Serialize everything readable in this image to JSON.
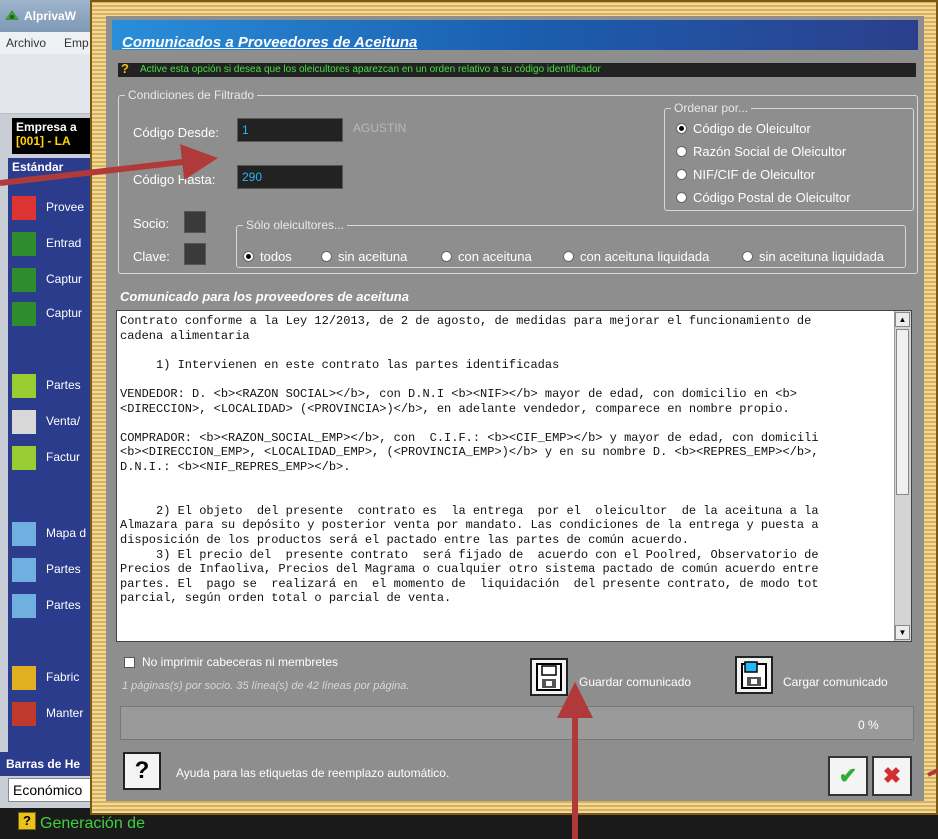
{
  "background_app": {
    "title": "AlprivaW",
    "menu": [
      "Archivo",
      "Emp"
    ],
    "company_line1": "Empresa a",
    "company_line2": "[001] - LA",
    "sidebar_header": "Estándar",
    "sidebar_items": [
      {
        "label": "Provee",
        "icon": "arrow-icon"
      },
      {
        "label": "Entrad",
        "icon": "olive-branch-icon"
      },
      {
        "label": "Captur",
        "icon": "olive-branch-icon"
      },
      {
        "label": "Captur",
        "icon": "olive-branch-icon"
      },
      {
        "label": "Partes",
        "icon": "jar-icon"
      },
      {
        "label": "Venta/",
        "icon": "document-icon"
      },
      {
        "label": "Factur",
        "icon": "jar-icon"
      },
      {
        "label": "Mapa d",
        "icon": "bars-icon"
      },
      {
        "label": "Partes",
        "icon": "bars-icon"
      },
      {
        "label": "Partes",
        "icon": "bars-icon"
      },
      {
        "label": "Fabric",
        "icon": "factory-icon"
      },
      {
        "label": "Manter",
        "icon": "maintenance-icon"
      }
    ],
    "barras_label": "Barras de He",
    "economico_value": "Económico",
    "status_text": "Generación de"
  },
  "dialog": {
    "title": "Comunicados a Proveedores de Aceituna",
    "hint": "Active esta opción si desea que los oleicultores aparezcan en un orden relativo a su código identificador",
    "filter_legend": "Condiciones de Filtrado",
    "codigo_desde_label": "Código Desde:",
    "codigo_desde_value": "1",
    "codigo_desde_name": "AGUSTIN",
    "codigo_hasta_label": "Código Hasta:",
    "codigo_hasta_value": "290",
    "socio_label": "Socio:",
    "clave_label": "Clave:",
    "order_legend": "Ordenar por...",
    "order_options": [
      {
        "label": "Código de Oleicultor",
        "selected": true
      },
      {
        "label": "Razón Social de Oleicultor",
        "selected": false
      },
      {
        "label": "NIF/CIF de Oleicultor",
        "selected": false
      },
      {
        "label": "Código Postal de Oleicultor",
        "selected": false
      }
    ],
    "solo_legend": "Sólo oleicultores...",
    "solo_options": [
      {
        "label": "todos",
        "selected": true
      },
      {
        "label": "sin aceituna",
        "selected": false
      },
      {
        "label": "con aceituna",
        "selected": false
      },
      {
        "label": "con aceituna liquidada",
        "selected": false
      },
      {
        "label": "sin aceituna liquidada",
        "selected": false
      }
    ],
    "comunicado_title": "Comunicado para los proveedores de aceituna",
    "comunicado_text": [
      "Contrato conforme a la Ley 12/2013, de 2 de agosto, de medidas para mejorar el funcionamiento de",
      "cadena alimentaria",
      "",
      "     1) Intervienen en este contrato las partes identificadas",
      "",
      "VENDEDOR: D. <b><RAZON SOCIAL></b>, con D.N.I <b><NIF></b> mayor de edad, con domicilio en <b>",
      "<DIRECCION>, <LOCALIDAD> (<PROVINCIA>)</b>, en adelante vendedor, comparece en nombre propio.",
      "",
      "COMPRADOR: <b><RAZON_SOCIAL_EMP></b>, con  C.I.F.: <b><CIF_EMP></b> y mayor de edad, con domicili",
      "<b><DIRECCION_EMP>, <LOCALIDAD_EMP>, (<PROVINCIA_EMP>)</b> y en su nombre D. <b><REPRES_EMP></b>,",
      "D.N.I.: <b><NIF_REPRES_EMP></b>.",
      "",
      "",
      "     2) El objeto  del presente  contrato es  la entrega  por el  oleicultor  de la aceituna a la",
      "Almazara para su depósito y posterior venta por mandato. Las condiciones de la entrega y puesta a",
      "disposición de los productos será el pactado entre las partes de común acuerdo.",
      "     3) El precio del  presente contrato  será fijado de  acuerdo con el Poolred, Observatorio de",
      "Precios de Infaoliva, Precios del Magrama o cualquier otro sistema pactado de común acuerdo entre",
      "partes. El  pago se  realizará en  el momento de  liquidación  del presente contrato, de modo tot",
      "parcial, según orden total o parcial de venta."
    ],
    "no_imprimir_label": "No imprimir cabeceras ni membretes",
    "no_imprimir_checked": false,
    "pages_info": "1 páginas(s) por socio. 35 línea(s) de 42 líneas por página.",
    "guardar_label": "Guardar comunicado",
    "cargar_label": "Cargar comunicado",
    "progress_value": 0,
    "progress_text": "0 %",
    "help_symbol": "?",
    "help_label": "Ayuda para las etiquetas de reemplazo automático.",
    "ok_symbol": "✔",
    "cancel_symbol": "✖"
  },
  "colors": {
    "title_gradient_start": "#2a8ed8",
    "title_gradient_end": "#2b3f8c",
    "hint_text": "#44e040",
    "field_text": "#29b6f6",
    "annotation_arrow": "#b03a3a",
    "frame": "#d8b25a"
  }
}
